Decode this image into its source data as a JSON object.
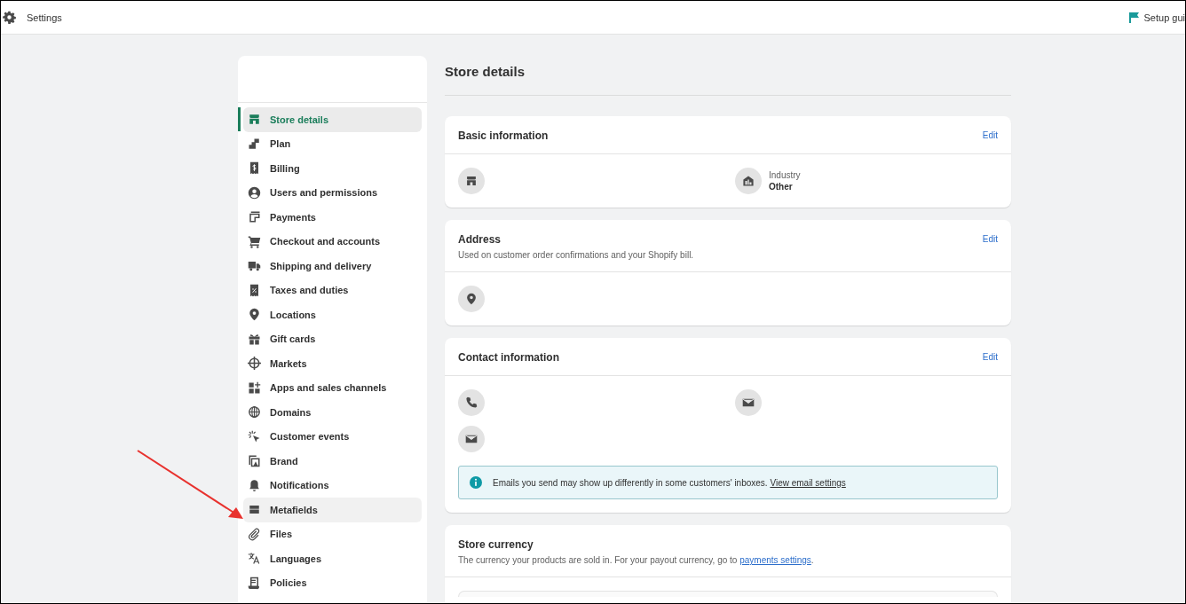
{
  "top_bar": {
    "title": "Settings",
    "setup_guide": "Setup gui"
  },
  "sidebar": {
    "items": [
      {
        "label": "Store details",
        "selected": true,
        "hovered": false
      },
      {
        "label": "Plan",
        "selected": false,
        "hovered": false
      },
      {
        "label": "Billing",
        "selected": false,
        "hovered": false
      },
      {
        "label": "Users and permissions",
        "selected": false,
        "hovered": false
      },
      {
        "label": "Payments",
        "selected": false,
        "hovered": false
      },
      {
        "label": "Checkout and accounts",
        "selected": false,
        "hovered": false
      },
      {
        "label": "Shipping and delivery",
        "selected": false,
        "hovered": false
      },
      {
        "label": "Taxes and duties",
        "selected": false,
        "hovered": false
      },
      {
        "label": "Locations",
        "selected": false,
        "hovered": false
      },
      {
        "label": "Gift cards",
        "selected": false,
        "hovered": false
      },
      {
        "label": "Markets",
        "selected": false,
        "hovered": false
      },
      {
        "label": "Apps and sales channels",
        "selected": false,
        "hovered": false
      },
      {
        "label": "Domains",
        "selected": false,
        "hovered": false
      },
      {
        "label": "Customer events",
        "selected": false,
        "hovered": false
      },
      {
        "label": "Brand",
        "selected": false,
        "hovered": false
      },
      {
        "label": "Notifications",
        "selected": false,
        "hovered": false
      },
      {
        "label": "Metafields",
        "selected": false,
        "hovered": true
      },
      {
        "label": "Files",
        "selected": false,
        "hovered": false
      },
      {
        "label": "Languages",
        "selected": false,
        "hovered": false
      },
      {
        "label": "Policies",
        "selected": false,
        "hovered": false
      }
    ]
  },
  "page_title": "Store details",
  "cards": [
    {
      "kind": "basic",
      "title": "Basic information",
      "action": "Edit",
      "industry": {
        "label": "Industry",
        "value": "Other"
      }
    },
    {
      "kind": "address",
      "title": "Address",
      "description": "Used on customer order confirmations and your Shopify bill.",
      "action": "Edit"
    },
    {
      "kind": "contact",
      "title": "Contact information",
      "action": "Edit",
      "banner": {
        "text": "Emails you send may show up differently in some customers' inboxes.",
        "link": "View email settings"
      }
    },
    {
      "kind": "currency",
      "title": "Store currency",
      "description": "The currency your products are sold in. For your payout currency, go to",
      "link": "payments settings",
      "suffix": "."
    }
  ]
}
